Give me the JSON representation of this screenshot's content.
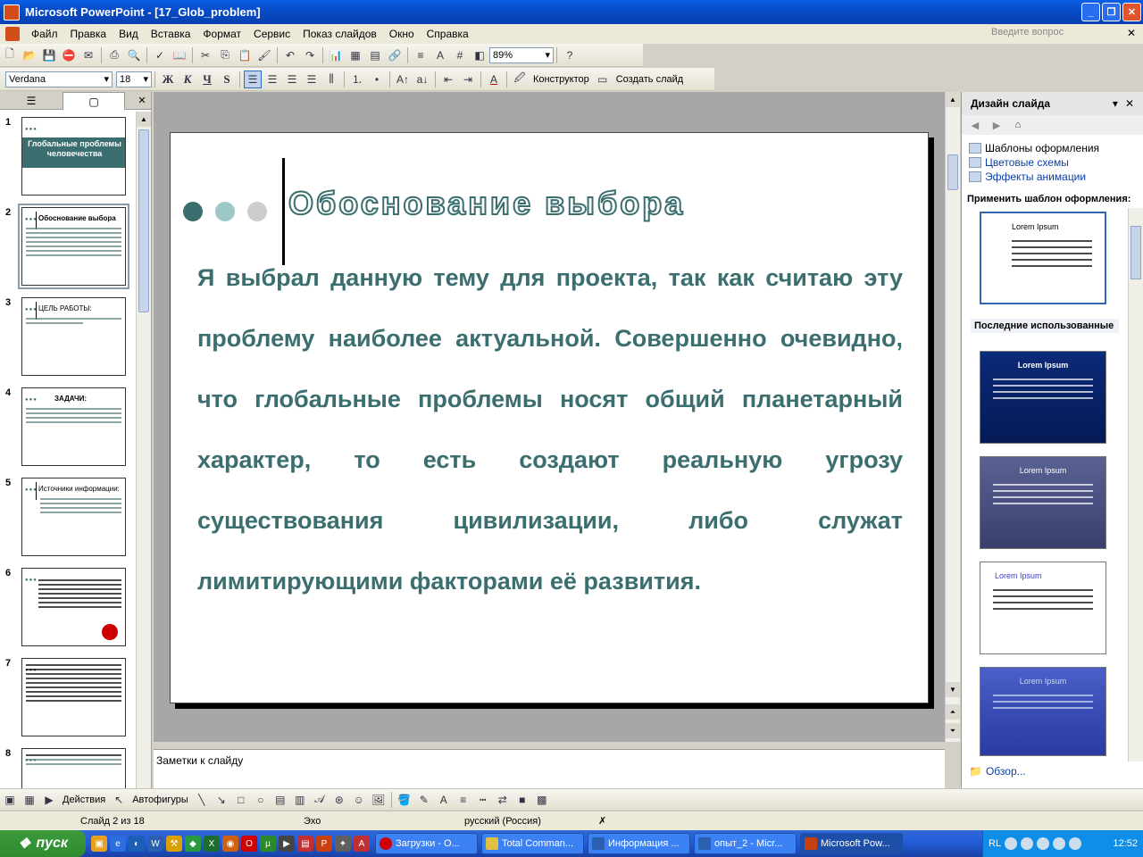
{
  "window": {
    "title": "Microsoft PowerPoint - [17_Glob_problem]"
  },
  "menu": {
    "items": [
      "Файл",
      "Правка",
      "Вид",
      "Вставка",
      "Формат",
      "Сервис",
      "Показ слайдов",
      "Окно",
      "Справка"
    ],
    "help_placeholder": "Введите вопрос"
  },
  "toolbar": {
    "zoom": "89%",
    "font": "Verdana",
    "font_size": "18",
    "bold": "Ж",
    "italic": "К",
    "underline": "Ч",
    "shadow": "S",
    "designer": "Конструктор",
    "new_slide": "Создать слайд"
  },
  "thumbnails": [
    {
      "num": "1",
      "title": "Глобальные проблемы человечества"
    },
    {
      "num": "2",
      "title": "Обоснование выбора"
    },
    {
      "num": "3",
      "title": "ЦЕЛЬ РАБОТЫ:"
    },
    {
      "num": "4",
      "title": "ЗАДАЧИ:"
    },
    {
      "num": "5",
      "title": "Источники информации:"
    },
    {
      "num": "6",
      "title": ""
    },
    {
      "num": "7",
      "title": ""
    },
    {
      "num": "8",
      "title": ""
    }
  ],
  "slide": {
    "title": "Обоснование выбора",
    "body": "Я выбрал данную тему для проекта, так как считаю  эту проблему наиболее актуальной. Совершенно очевидно, что глобальные проблемы носят общий планетарный характер, то есть создают реальную угрозу существования цивилизации, либо служат лимитирующими факторами её развития.",
    "dot_colors": [
      "#3b6e6e",
      "#9cc7c7",
      "#cccccc"
    ],
    "text_color": "#3b6e6e"
  },
  "notes": {
    "placeholder": "Заметки к слайду"
  },
  "taskpane": {
    "title": "Дизайн слайда",
    "links": [
      "Шаблоны оформления",
      "Цветовые схемы",
      "Эффекты анимации"
    ],
    "apply_label": "Применить шаблон оформления:",
    "recent_label": "Последние использованные",
    "design_title": "Lorem Ipsum",
    "browse": "Обзор..."
  },
  "drawbar": {
    "actions": "Действия",
    "autoshapes": "Автофигуры"
  },
  "status": {
    "slide": "Слайд 2 из 18",
    "design": "Эхо",
    "language": "русский (Россия)"
  },
  "taskbar": {
    "start": "пуск",
    "tasks": [
      "Загрузки - О...",
      "Total Comman...",
      "Информация ...",
      "опыт_2 - Micr...",
      "Microsoft Pow..."
    ],
    "lang": "RL",
    "clock": "12:52"
  }
}
